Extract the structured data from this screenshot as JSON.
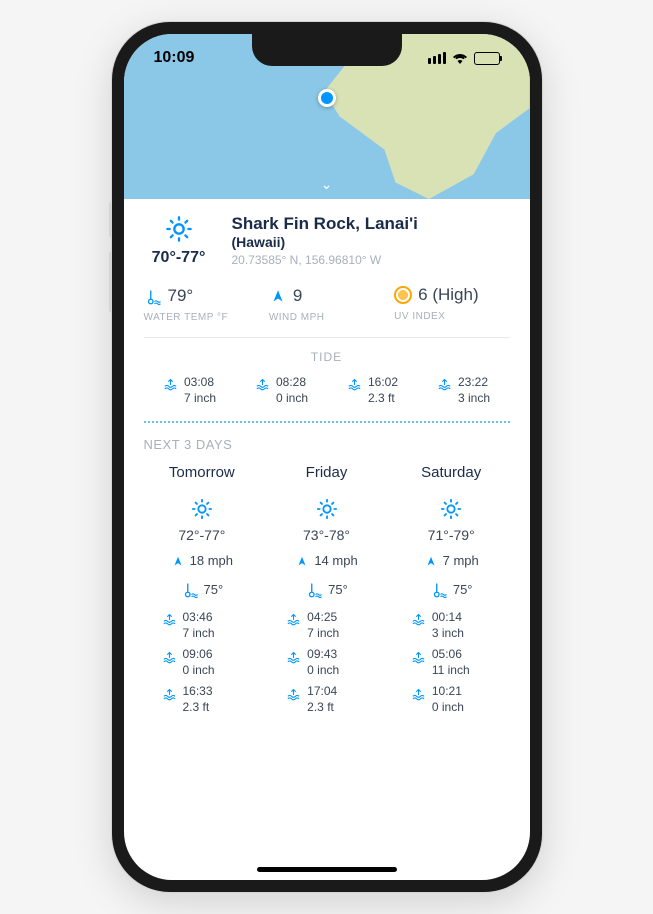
{
  "status": {
    "time": "10:09"
  },
  "location": {
    "name": "Shark Fin Rock, Lanai'i",
    "region": "(Hawaii)",
    "coords": "20.73585° N, 156.96810° W",
    "temp_range": "70°-77°"
  },
  "metrics": {
    "water_temp": {
      "value": "79°",
      "label": "WATER TEMP °F"
    },
    "wind": {
      "value": "9",
      "label": "WIND MPH"
    },
    "uv": {
      "value": "6 (High)",
      "label": "UV INDEX"
    }
  },
  "tide": {
    "heading": "TIDE",
    "items": [
      {
        "time": "03:08",
        "height": "7 inch"
      },
      {
        "time": "08:28",
        "height": "0 inch"
      },
      {
        "time": "16:02",
        "height": "2.3 ft"
      },
      {
        "time": "23:22",
        "height": "3 inch"
      }
    ]
  },
  "forecast": {
    "heading": "NEXT 3 DAYS",
    "days": [
      {
        "name": "Tomorrow",
        "temp_range": "72°-77°",
        "wind": "18 mph",
        "water_temp": "75°",
        "tides": [
          {
            "time": "03:46",
            "height": "7 inch"
          },
          {
            "time": "09:06",
            "height": "0 inch"
          },
          {
            "time": "16:33",
            "height": "2.3 ft"
          }
        ]
      },
      {
        "name": "Friday",
        "temp_range": "73°-78°",
        "wind": "14 mph",
        "water_temp": "75°",
        "tides": [
          {
            "time": "04:25",
            "height": "7 inch"
          },
          {
            "time": "09:43",
            "height": "0 inch"
          },
          {
            "time": "17:04",
            "height": "2.3 ft"
          }
        ]
      },
      {
        "name": "Saturday",
        "temp_range": "71°-79°",
        "wind": "7 mph",
        "water_temp": "75°",
        "tides": [
          {
            "time": "00:14",
            "height": "3 inch"
          },
          {
            "time": "05:06",
            "height": "11 inch"
          },
          {
            "time": "10:21",
            "height": "0 inch"
          }
        ]
      }
    ]
  }
}
